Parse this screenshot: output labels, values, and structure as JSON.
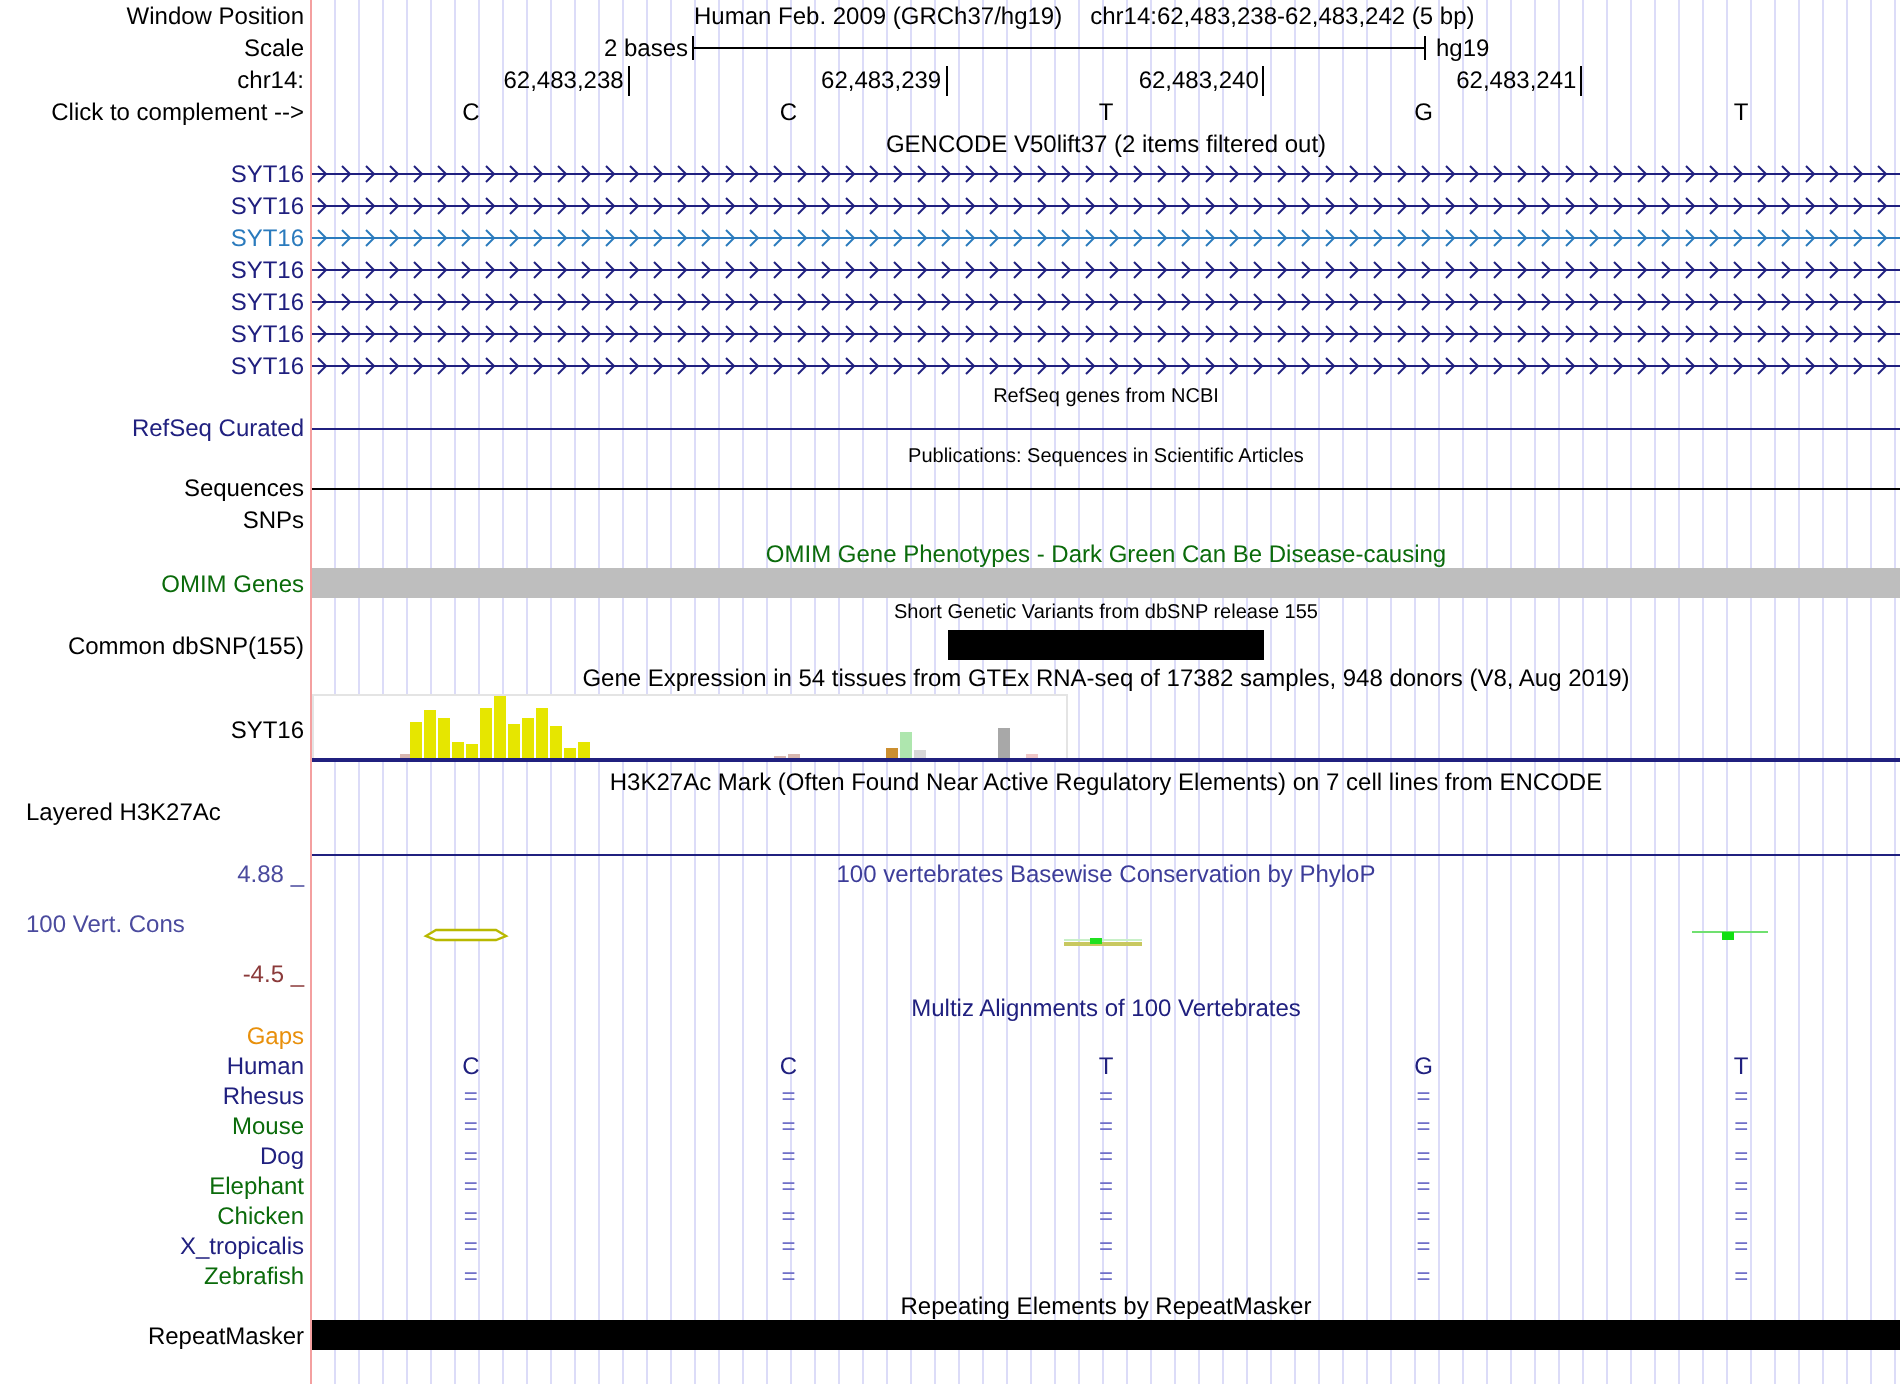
{
  "header": {
    "label": "Window Position",
    "assembly": "Human Feb. 2009 (GRCh37/hg19)",
    "position": "chr14:62,483,238-62,483,242 (5 bp)"
  },
  "scale": {
    "label": "Scale",
    "span": "2 bases",
    "assembly": "hg19"
  },
  "ruler": {
    "label": "chr14:",
    "positions": [
      "62,483,238",
      "62,483,239",
      "62,483,240",
      "62,483,241"
    ]
  },
  "bases": {
    "label": "Click to complement -->",
    "letters": [
      "C",
      "C",
      "T",
      "G",
      "T"
    ]
  },
  "tracks": [
    {
      "kind": "genes",
      "title": "GENCODE V50lift37 (2 items filtered out)",
      "items": [
        {
          "label": "SYT16",
          "color": "#20207f"
        },
        {
          "label": "SYT16",
          "color": "#20207f"
        },
        {
          "label": "SYT16",
          "color": "#2b7bbd"
        },
        {
          "label": "SYT16",
          "color": "#20207f"
        },
        {
          "label": "SYT16",
          "color": "#20207f"
        },
        {
          "label": "SYT16",
          "color": "#20207f"
        },
        {
          "label": "SYT16",
          "color": "#20207f"
        }
      ]
    },
    {
      "kind": "line",
      "title": "RefSeq genes from NCBI",
      "label": "RefSeq Curated",
      "color": "#20207f"
    },
    {
      "kind": "line",
      "title": "Publications: Sequences in Scientific Articles",
      "label": "Sequences",
      "color": "#000000"
    },
    {
      "kind": "empty",
      "label": "SNPs"
    },
    {
      "kind": "band",
      "title": "OMIM Gene Phenotypes - Dark Green Can Be Disease-causing",
      "label": "OMIM Genes",
      "color": "#0b6b0b"
    },
    {
      "kind": "variant",
      "title": "Short Genetic Variants from dbSNP release 155",
      "label": "Common dbSNP(155)"
    },
    {
      "kind": "expression",
      "title": "Gene Expression in 54 tissues from GTEx RNA-seq of 17382 samples, 948 donors (V8, Aug 2019)",
      "label": "SYT16"
    },
    {
      "kind": "layered",
      "title": "H3K27Ac Mark (Often Found Near Active Regulatory Elements) on 7 cell lines from ENCODE",
      "label": "Layered H3K27Ac"
    },
    {
      "kind": "wiggle",
      "title": "100 vertebrates Basewise Conservation by PhyloP",
      "label": "100 Vert. Cons",
      "max": "4.88 _",
      "min": "-4.5 _"
    },
    {
      "kind": "alignment",
      "title": "Multiz Alignments of 100 Vertebrates",
      "gaps": "Gaps",
      "species": [
        {
          "name": "Human",
          "color": "#20207f",
          "bases": [
            "C",
            "C",
            "T",
            "G",
            "T"
          ]
        },
        {
          "name": "Rhesus",
          "color": "#20207f",
          "bases": [
            "=",
            "=",
            "=",
            "=",
            "="
          ]
        },
        {
          "name": "Mouse",
          "color": "#0b6b0b",
          "bases": [
            "=",
            "=",
            "=",
            "=",
            "="
          ]
        },
        {
          "name": "Dog",
          "color": "#20207f",
          "bases": [
            "=",
            "=",
            "=",
            "=",
            "="
          ]
        },
        {
          "name": "Elephant",
          "color": "#0b6b0b",
          "bases": [
            "=",
            "=",
            "=",
            "=",
            "="
          ]
        },
        {
          "name": "Chicken",
          "color": "#0b6b0b",
          "bases": [
            "=",
            "=",
            "=",
            "=",
            "="
          ]
        },
        {
          "name": "X_tropicalis",
          "color": "#20207f",
          "bases": [
            "=",
            "=",
            "=",
            "=",
            "="
          ]
        },
        {
          "name": "Zebrafish",
          "color": "#0b6b0b",
          "bases": [
            "=",
            "=",
            "=",
            "=",
            "="
          ]
        }
      ]
    },
    {
      "kind": "bar",
      "title": "Repeating Elements by RepeatMasker",
      "label": "RepeatMasker"
    }
  ]
}
